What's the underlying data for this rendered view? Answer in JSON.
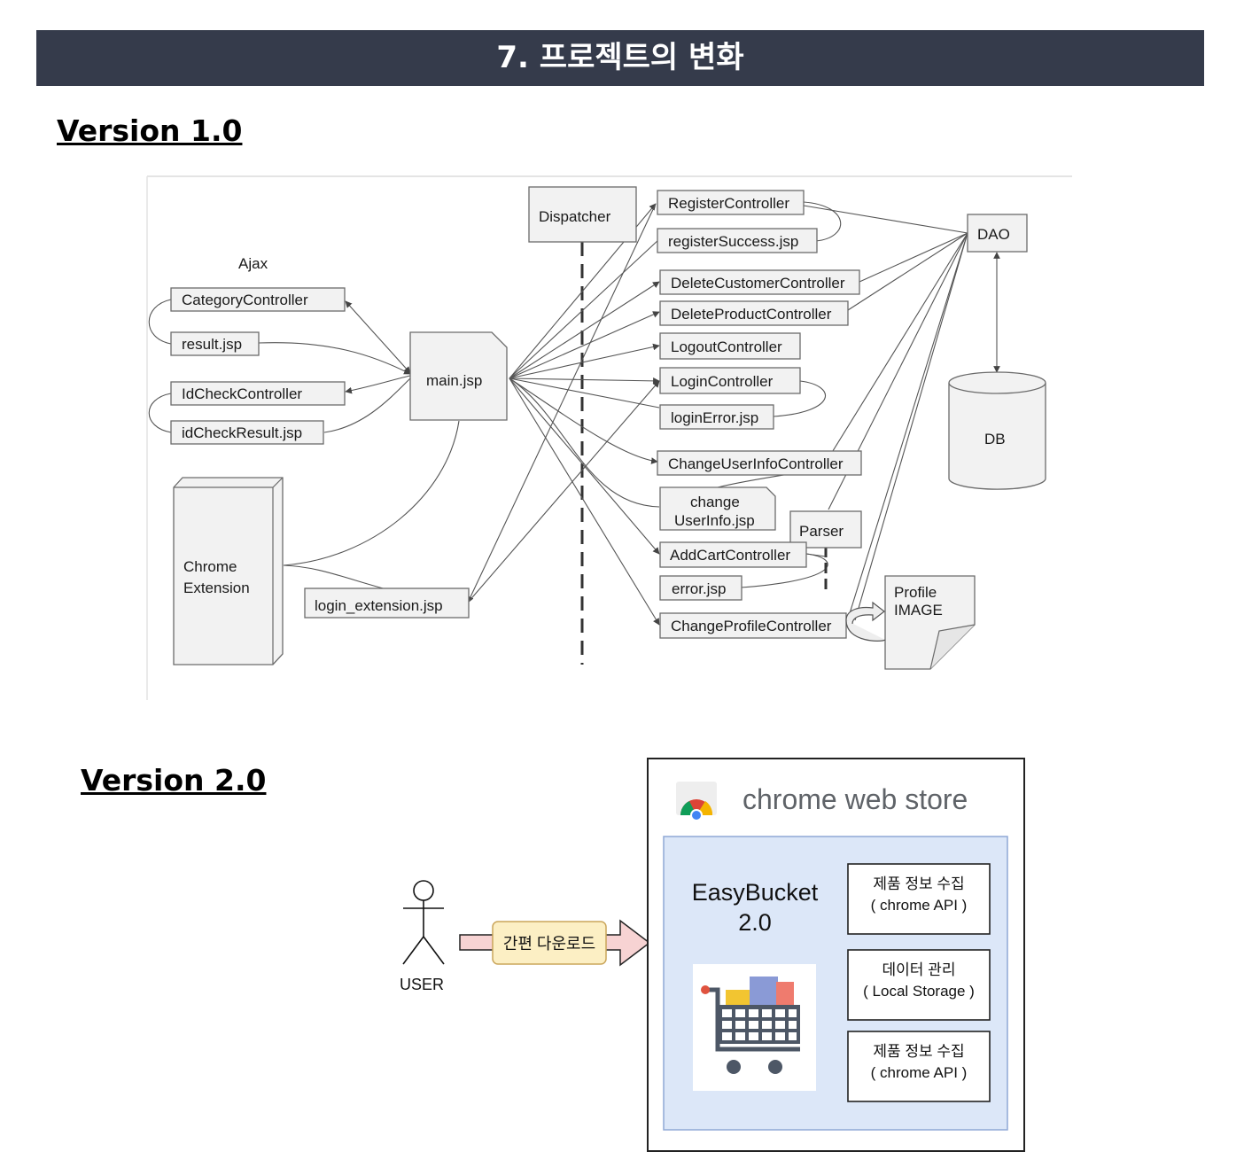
{
  "header": {
    "title": "7. 프로젝트의 변화"
  },
  "v1": {
    "heading": "Version 1.0",
    "labels": {
      "ajax": "Ajax",
      "category_controller": "CategoryController",
      "result_jsp": "result.jsp",
      "idcheck_controller": "IdCheckController",
      "idcheck_result_jsp": "idCheckResult.jsp",
      "main_jsp": "main.jsp",
      "chrome_extension_line1": "Chrome",
      "chrome_extension_line2": "Extension",
      "login_extension_jsp": "login_extension.jsp",
      "dispatcher": "Dispatcher",
      "register_controller": "RegisterController",
      "register_success_jsp": "registerSuccess.jsp",
      "delete_customer_controller": "DeleteCustomerController",
      "delete_product_controller": "DeleteProductController",
      "logout_controller": "LogoutController",
      "login_controller": "LoginController",
      "login_error_jsp": "loginError.jsp",
      "change_userinfo_controller": "ChangeUserInfoController",
      "change_userinfo_jsp_line1": "change",
      "change_userinfo_jsp_line2": "UserInfo.jsp",
      "parser": "Parser",
      "add_cart_controller": "AddCartController",
      "error_jsp": "error.jsp",
      "change_profile_controller": "ChangeProfileController",
      "profile_image_line1": "Profile",
      "profile_image_line2": "IMAGE",
      "dao": "DAO",
      "db": "DB"
    }
  },
  "v2": {
    "heading": "Version 2.0",
    "user_label": "USER",
    "download_label": "간편 다운로드",
    "store_title": "chrome web store",
    "app_name_line1": "EasyBucket",
    "app_name_line2": "2.0",
    "features": [
      {
        "line1": "제품 정보 수집",
        "line2": "( chrome API )"
      },
      {
        "line1": "데이터 관리",
        "line2": "( Local Storage )"
      },
      {
        "line1": "제품 정보 수집",
        "line2": "( chrome API )"
      }
    ]
  },
  "colors": {
    "banner_bg": "#353b4b",
    "panel_bg": "#dce7f8",
    "download_bg": "#fcefc4",
    "arrow_fill": "#f7d3d3"
  }
}
